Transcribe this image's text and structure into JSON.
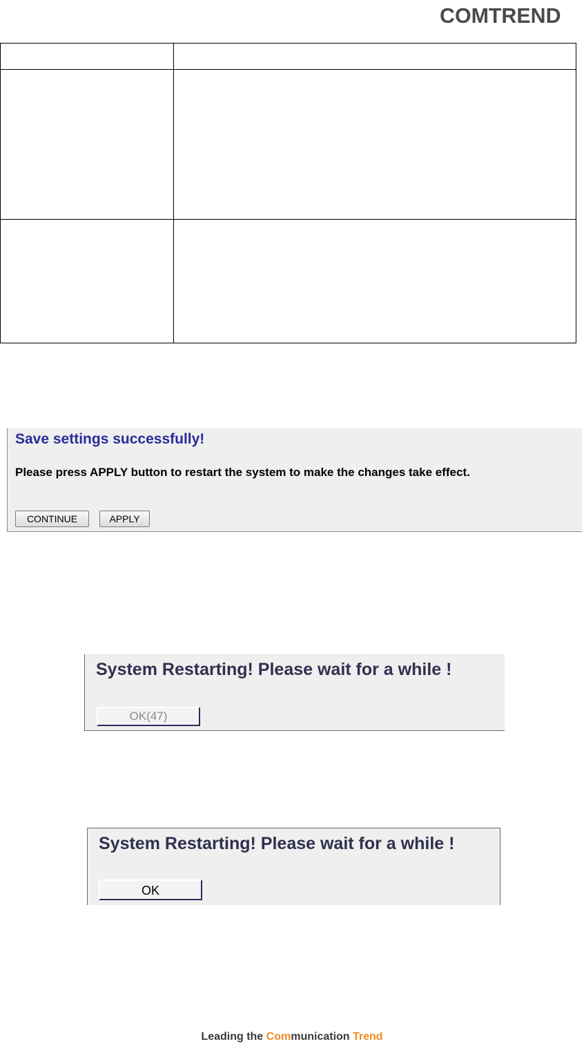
{
  "header": {
    "logo_text": "COMTREND",
    "logo_color": "#4a4a4a"
  },
  "save_dialog": {
    "title": "Save settings successfully!",
    "message": "Please press APPLY button to restart the system to make the changes take effect.",
    "continue_label": "CONTINUE",
    "apply_label": "APPLY",
    "title_color": "#2b2b9a"
  },
  "restart_dialog_countdown": {
    "title": "System Restarting! Please wait for a while !",
    "ok_label": "OK(47)"
  },
  "restart_dialog_done": {
    "title": "System Restarting! Please wait for a while !",
    "ok_label": "OK"
  },
  "footer": {
    "part1": "Leading the ",
    "part2": "Com",
    "part3": "munication ",
    "part4": "Trend",
    "accent_color": "#f08a24"
  }
}
